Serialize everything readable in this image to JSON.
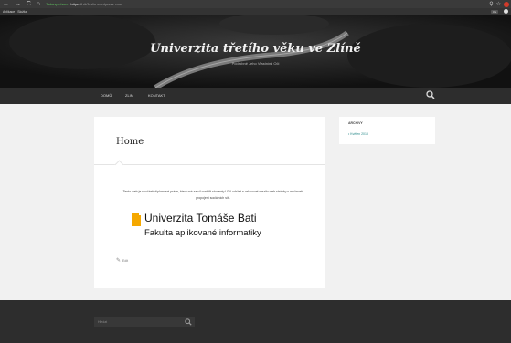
{
  "browser": {
    "nav_icons": "← → C ⌂",
    "secure_label": "Zabezpečeno",
    "url_host": "https://",
    "url_rest": "utb3vzlin.wordpress.com",
    "zoom_icon": "search-icon",
    "star_icon": "star-icon"
  },
  "bookmarks": {
    "item1": "Aplikace",
    "item2": "Složka",
    "right_badge": "3 s"
  },
  "site": {
    "title": "Univerzita třetího věku ve Zlíně",
    "description": "Podrobně Jeho Vlastními Oči"
  },
  "menu": {
    "items": [
      "DOMŮ",
      "ZLIN",
      "KONTAKT"
    ]
  },
  "post": {
    "title": "Home",
    "text": "Tento web je součástí diplomové práce, která má za cíl rozšířit studenty U3V udržet a oslovovat mezitu web stránky s možností propojení sociálních sítí.",
    "logo_line1": "Univerzita Tomáše Bati",
    "logo_line2": "Fakulta aplikované informatiky",
    "edit_label": "Edit"
  },
  "widget": {
    "title": "ARCHIVY",
    "link": "• Květen 2018"
  },
  "footer": {
    "search_placeholder": "Hledat"
  }
}
